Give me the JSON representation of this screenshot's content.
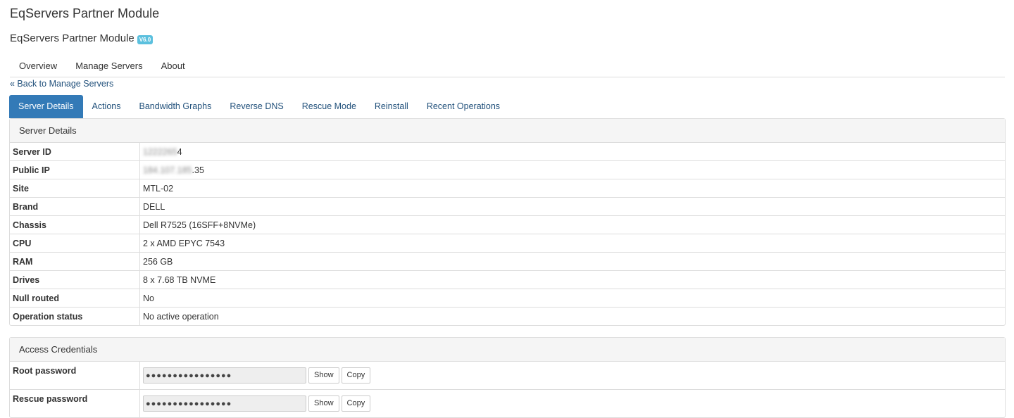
{
  "header": {
    "page_title": "EqServers Partner Module",
    "module_title": "EqServers Partner Module",
    "version_badge": "V6.0"
  },
  "topnav": {
    "items": [
      "Overview",
      "Manage Servers",
      "About"
    ]
  },
  "back_link": "« Back to Manage Servers",
  "tabs": {
    "items": [
      "Server Details",
      "Actions",
      "Bandwidth Graphs",
      "Reverse DNS",
      "Rescue Mode",
      "Reinstall",
      "Recent Operations"
    ],
    "active": "Server Details"
  },
  "server_details": {
    "heading": "Server Details",
    "rows": [
      {
        "label": "Server ID",
        "value_hidden": "1222265",
        "value": "4"
      },
      {
        "label": "Public IP",
        "value_hidden": "184.107.185",
        "value": ".35"
      },
      {
        "label": "Site",
        "value": "MTL-02"
      },
      {
        "label": "Brand",
        "value": "DELL"
      },
      {
        "label": "Chassis",
        "value": "Dell R7525 (16SFF+8NVMe)"
      },
      {
        "label": "CPU",
        "value": "2 x AMD EPYC 7543"
      },
      {
        "label": "RAM",
        "value": "256 GB"
      },
      {
        "label": "Drives",
        "value": "8 x 7.68 TB NVME"
      },
      {
        "label": "Null routed",
        "value": "No"
      },
      {
        "label": "Operation status",
        "value": "No active operation"
      }
    ]
  },
  "credentials": {
    "heading": "Access Credentials",
    "rows": [
      {
        "label": "Root password",
        "masked": "●●●●●●●●●●●●●●●●",
        "show_label": "Show",
        "copy_label": "Copy"
      },
      {
        "label": "Rescue password",
        "masked": "●●●●●●●●●●●●●●●●",
        "show_label": "Show",
        "copy_label": "Copy"
      }
    ]
  }
}
